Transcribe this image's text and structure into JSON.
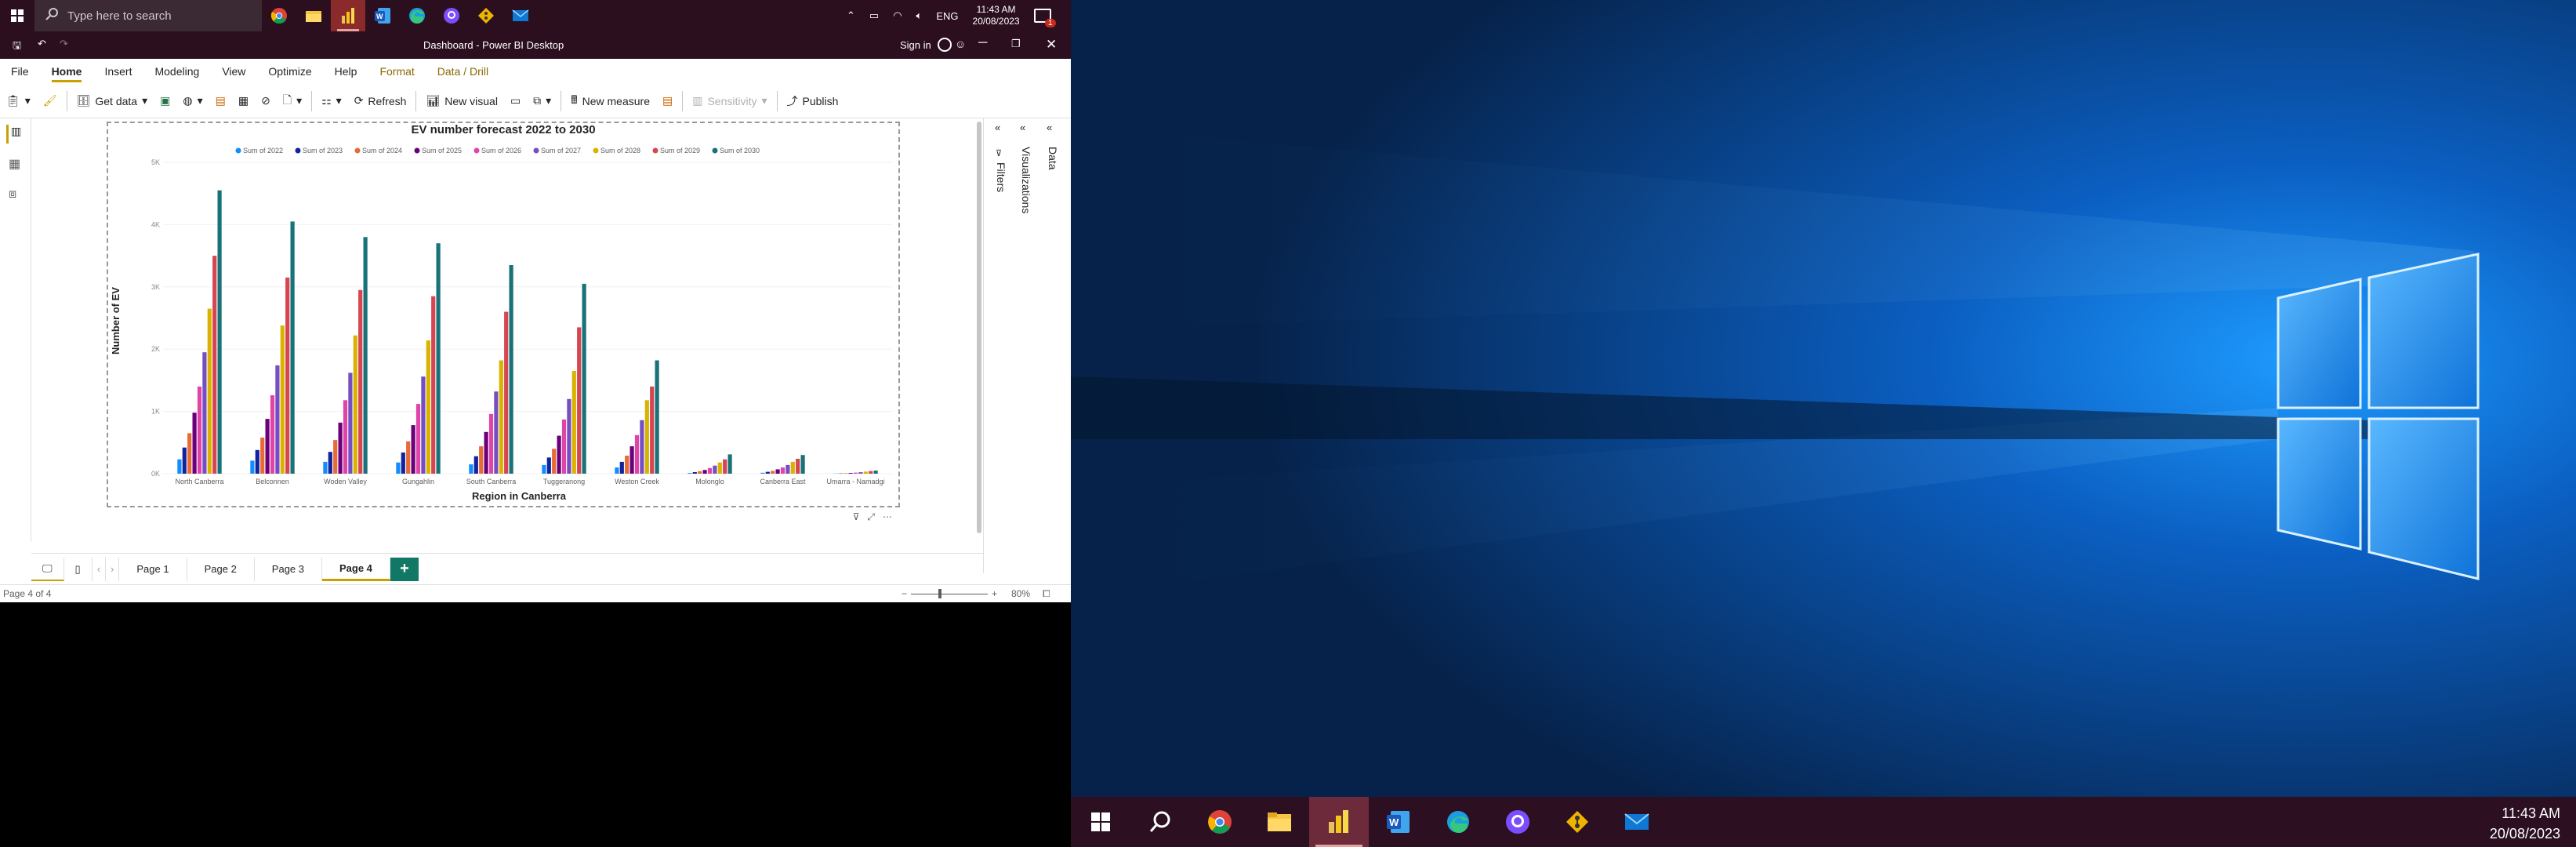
{
  "left_taskbar": {
    "search_placeholder": "Type here to search",
    "lang": "ENG",
    "time": "11:43 AM",
    "date": "20/08/2023",
    "notif_count": "1"
  },
  "window": {
    "title": "Dashboard - Power BI Desktop",
    "signin": "Sign in"
  },
  "ribbon_tabs": [
    "File",
    "Home",
    "Insert",
    "Modeling",
    "View",
    "Optimize",
    "Help",
    "Format",
    "Data / Drill"
  ],
  "ribbon": {
    "get_data": "Get data",
    "refresh": "Refresh",
    "new_visual": "New visual",
    "new_measure": "New measure",
    "sensitivity": "Sensitivity",
    "publish": "Publish"
  },
  "panes": {
    "filters": "Filters",
    "visualizations": "Visualizations",
    "data": "Data"
  },
  "pages": [
    "Page 1",
    "Page 2",
    "Page 3",
    "Page 4"
  ],
  "status": {
    "page_info": "Page 4 of 4",
    "zoom": "80%"
  },
  "right_taskbar": {
    "time": "11:43 AM",
    "date": "20/08/2023"
  },
  "colors": {
    "accent": "#c8a000",
    "taskbar": "#2b0f1e"
  },
  "chart_data": {
    "type": "bar",
    "title": "EV number forecast 2022 to 2030",
    "xlabel": "Region in Canberra",
    "ylabel": "Number of EV",
    "ylim": [
      0,
      5000
    ],
    "yticks": [
      "0K",
      "1K",
      "2K",
      "3K",
      "4K",
      "5K"
    ],
    "legend_position": "top",
    "categories": [
      "North Canberra",
      "Belconnen",
      "Woden Valley",
      "Gungahlin",
      "South Canberra",
      "Tuggeranong",
      "Weston Creek",
      "Molonglo",
      "Canberra East",
      "Umarra - Namadgi"
    ],
    "series": [
      {
        "name": "Sum of 2022",
        "color": "#118dff",
        "values": [
          230,
          210,
          190,
          180,
          150,
          140,
          100,
          12,
          15,
          3
        ]
      },
      {
        "name": "Sum of 2023",
        "color": "#12239e",
        "values": [
          420,
          380,
          350,
          340,
          280,
          260,
          190,
          25,
          30,
          5
        ]
      },
      {
        "name": "Sum of 2024",
        "color": "#e66c37",
        "values": [
          650,
          580,
          540,
          520,
          440,
          400,
          290,
          40,
          45,
          8
        ]
      },
      {
        "name": "Sum of 2025",
        "color": "#6b007b",
        "values": [
          980,
          880,
          820,
          780,
          670,
          610,
          440,
          60,
          70,
          12
        ]
      },
      {
        "name": "Sum of 2026",
        "color": "#e044a7",
        "values": [
          1400,
          1260,
          1180,
          1120,
          960,
          870,
          620,
          90,
          100,
          17
        ]
      },
      {
        "name": "Sum of 2027",
        "color": "#744ec2",
        "values": [
          1950,
          1740,
          1620,
          1560,
          1320,
          1200,
          860,
          130,
          140,
          24
        ]
      },
      {
        "name": "Sum of 2028",
        "color": "#d9b300",
        "values": [
          2650,
          2380,
          2220,
          2140,
          1820,
          1650,
          1180,
          180,
          190,
          33
        ]
      },
      {
        "name": "Sum of 2029",
        "color": "#d64550",
        "values": [
          3500,
          3150,
          2950,
          2850,
          2600,
          2350,
          1400,
          230,
          240,
          42
        ]
      },
      {
        "name": "Sum of 2030",
        "color": "#197278",
        "values": [
          4550,
          4050,
          3800,
          3700,
          3350,
          3050,
          1820,
          310,
          300,
          50
        ]
      }
    ]
  }
}
